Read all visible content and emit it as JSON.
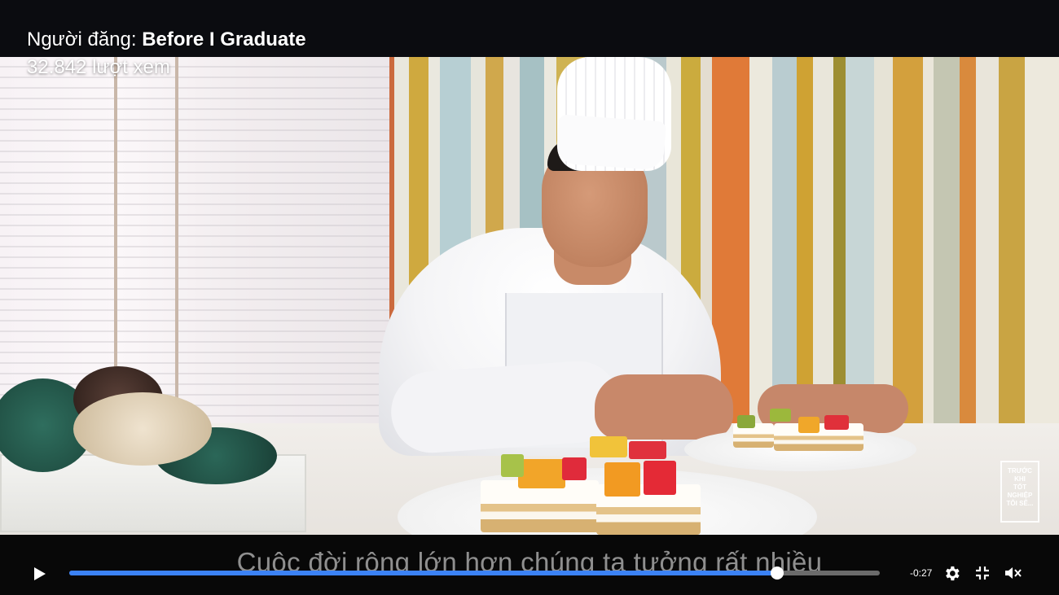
{
  "header": {
    "uploader_prefix": "Người đăng: ",
    "uploader_name": "Before I Graduate",
    "views": "32.842 lượt xem"
  },
  "video": {
    "subtitle": "Cuộc đời rộng lớn hơn chúng ta tưởng rất nhiều",
    "watermark_lines": [
      "TRƯỚC",
      "KHI",
      "TỐT NGHIỆP",
      "TÔI SẼ..."
    ]
  },
  "player": {
    "time_remaining": "-0:27",
    "progress_fraction": 0.873,
    "icons": {
      "play": "play-icon",
      "settings": "gear-icon",
      "fullscreen_exit": "exit-fullscreen-icon",
      "mute": "muted-speaker-icon"
    },
    "accent_color": "#3b82f6"
  }
}
